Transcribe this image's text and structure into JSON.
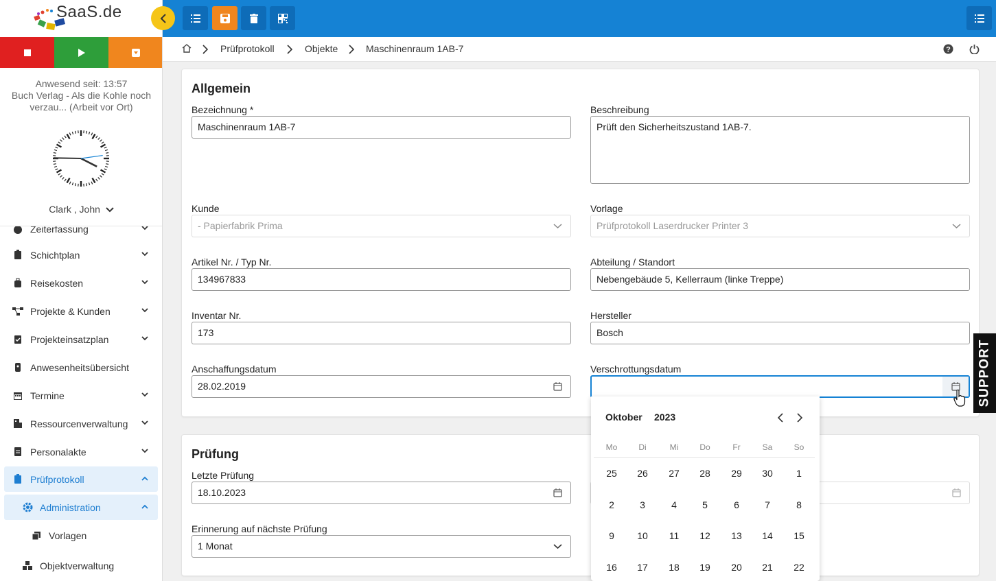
{
  "app": {
    "logo_text": "SaaS.de"
  },
  "sidebar": {
    "presence_line": "Anwesend seit: 13:57",
    "presence_activity": "Buch Verlag - Als die Kohle noch verzau... (Arbeit vor Ort)",
    "user_name": "Clark , John",
    "menu": [
      {
        "label": "Zeiterfassung",
        "icon": "stopwatch-icon"
      },
      {
        "label": "Schichtplan",
        "icon": "clipboard-icon"
      },
      {
        "label": "Reisekosten",
        "icon": "suitcase-icon"
      },
      {
        "label": "Projekte & Kunden",
        "icon": "project-tree-icon"
      },
      {
        "label": "Projekteinsatzplan",
        "icon": "clipboard-check-icon"
      },
      {
        "label": "Anwesenheitsübersicht",
        "icon": "badge-icon"
      },
      {
        "label": "Termine",
        "icon": "calendar-icon"
      },
      {
        "label": "Ressourcenverwaltung",
        "icon": "building-icon"
      },
      {
        "label": "Personalakte",
        "icon": "file-icon"
      },
      {
        "label": "Prüfprotokoll",
        "icon": "clipboard-icon"
      },
      {
        "label": "Administration",
        "icon": "gear-icon"
      },
      {
        "label": "Vorlagen",
        "icon": "copy-icon"
      },
      {
        "label": "Objektverwaltung",
        "icon": "cubes-icon"
      }
    ]
  },
  "breadcrumb": [
    "Prüfprotokoll",
    "Objekte",
    "Maschinenraum 1AB-7"
  ],
  "general": {
    "title": "Allgemein",
    "bezeichnung_label": "Bezeichnung *",
    "bezeichnung_value": "Maschinenraum 1AB-7",
    "beschreibung_label": "Beschreibung",
    "beschreibung_value": "Prüft den Sicherheitszustand 1AB-7.",
    "kunde_label": "Kunde",
    "kunde_value": "- Papierfabrik Prima",
    "vorlage_label": "Vorlage",
    "vorlage_value": "Prüfprotokoll Laserdrucker Printer 3",
    "artikel_label": "Artikel Nr. / Typ Nr.",
    "artikel_value": "134967833",
    "abteilung_label": "Abteilung / Standort",
    "abteilung_value": "Nebengebäude 5, Kellerraum (linke Treppe)",
    "inventar_label": "Inventar Nr.",
    "inventar_value": "173",
    "hersteller_label": "Hersteller",
    "hersteller_value": "Bosch",
    "anschaffung_label": "Anschaffungsdatum",
    "anschaffung_value": "28.02.2019",
    "verschrottung_label": "Verschrottungsdatum",
    "verschrottung_value": ""
  },
  "pruefung": {
    "title": "Prüfung",
    "letzte_label": "Letzte Prüfung",
    "letzte_value": "18.10.2023",
    "erinnerung_label": "Erinnerung auf nächste Prüfung",
    "erinnerung_value": "1 Monat"
  },
  "calendar": {
    "month": "Oktober",
    "year": "2023",
    "weekdays": [
      "Mo",
      "Di",
      "Mi",
      "Do",
      "Fr",
      "Sa",
      "So"
    ],
    "weeks": [
      [
        "25",
        "26",
        "27",
        "28",
        "29",
        "30",
        "1"
      ],
      [
        "2",
        "3",
        "4",
        "5",
        "6",
        "7",
        "8"
      ],
      [
        "9",
        "10",
        "11",
        "12",
        "13",
        "14",
        "15"
      ],
      [
        "16",
        "17",
        "18",
        "19",
        "20",
        "21",
        "22"
      ]
    ]
  },
  "support_label": "SUPPORT",
  "colors": {
    "primary": "#1582d4",
    "stop": "#e02020",
    "play": "#2e9e3a",
    "pause": "#f0861e",
    "accent_yellow": "#f5c518"
  }
}
